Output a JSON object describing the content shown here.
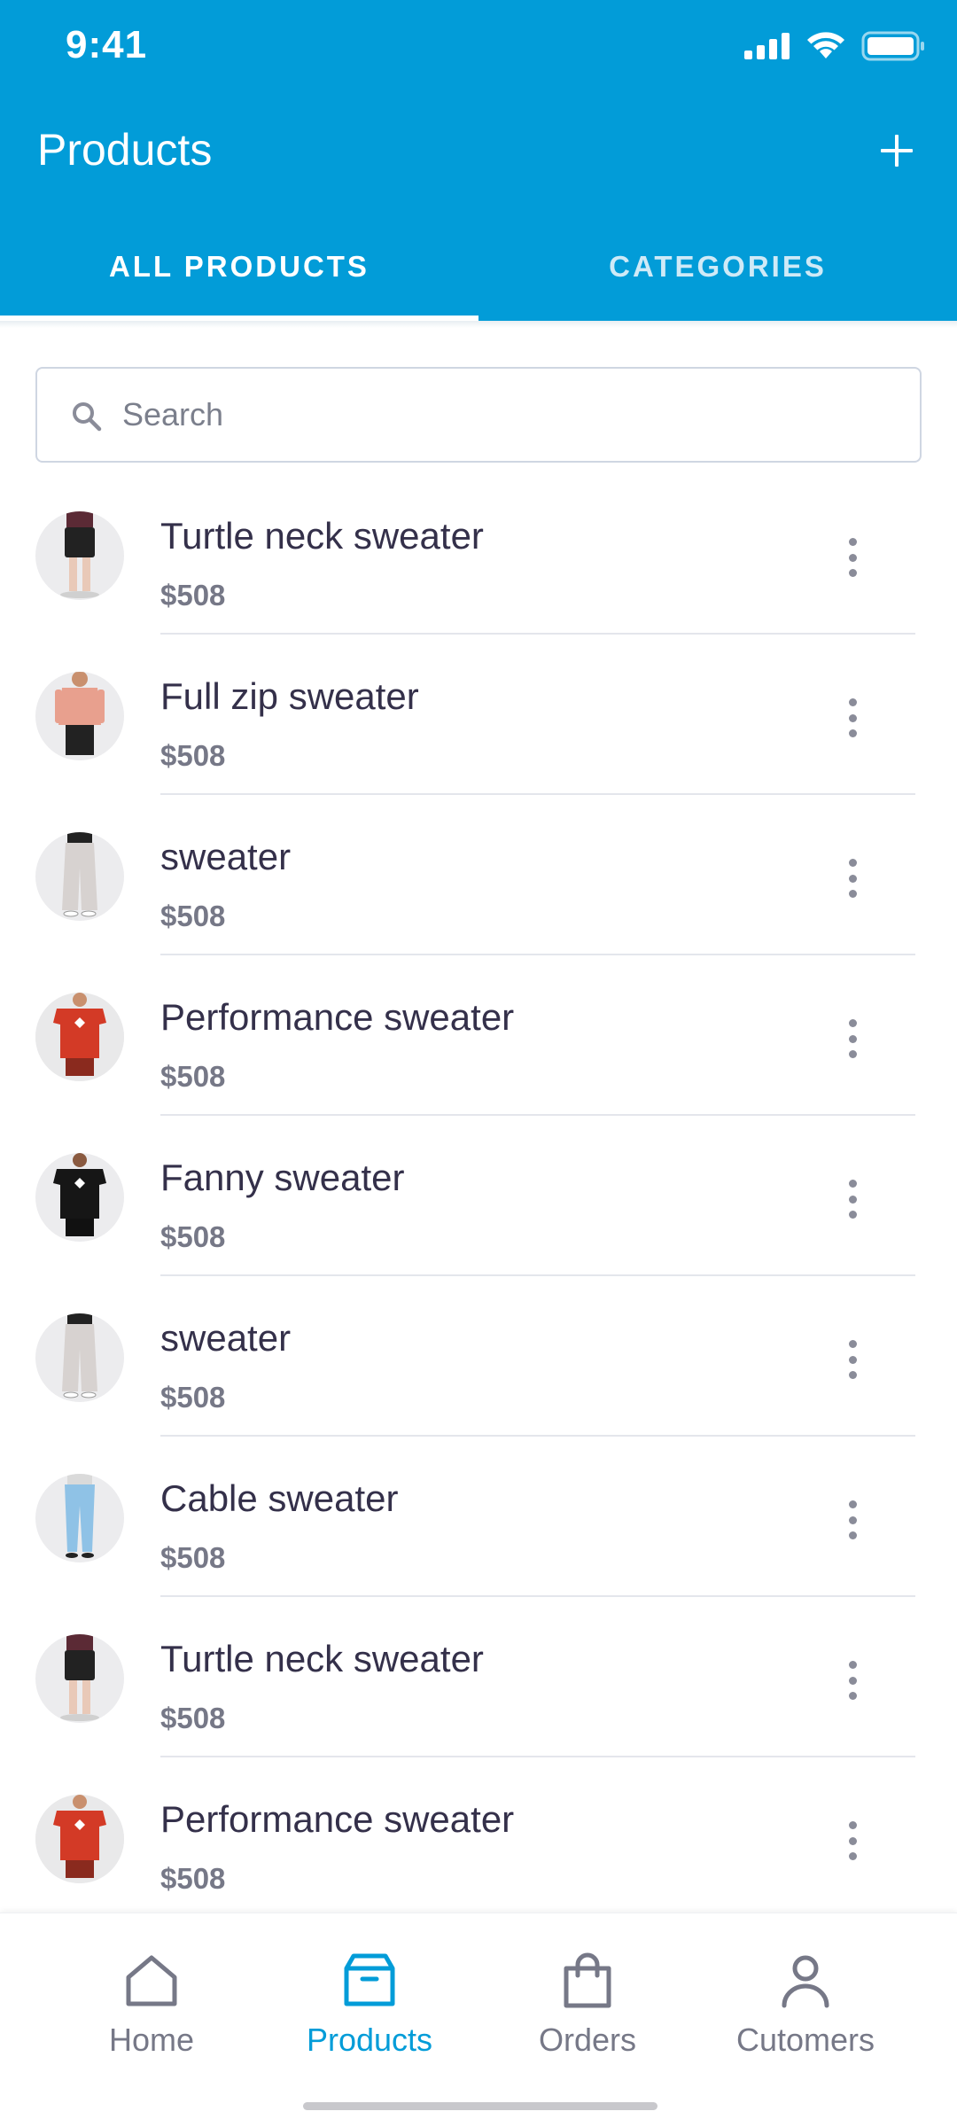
{
  "status_bar": {
    "time": "9:41"
  },
  "header": {
    "title": "Products",
    "add_icon": "plus-icon"
  },
  "tabs": [
    {
      "label": "ALL PRODUCTS",
      "active": true
    },
    {
      "label": "CATEGORIES",
      "active": false
    }
  ],
  "search": {
    "placeholder": "Search",
    "value": ""
  },
  "products": [
    {
      "name": "Turtle neck sweater",
      "price": "$508",
      "thumb": "black-shorts"
    },
    {
      "name": "Full zip sweater",
      "price": "$508",
      "thumb": "pink-top"
    },
    {
      "name": "sweater",
      "price": "$508",
      "thumb": "beige-pants"
    },
    {
      "name": "Performance sweater",
      "price": "$508",
      "thumb": "red-tee"
    },
    {
      "name": "Fanny sweater",
      "price": "$508",
      "thumb": "black-tee"
    },
    {
      "name": "sweater",
      "price": "$508",
      "thumb": "beige-pants"
    },
    {
      "name": "Cable sweater",
      "price": "$508",
      "thumb": "blue-jeans"
    },
    {
      "name": "Turtle neck sweater",
      "price": "$508",
      "thumb": "black-shorts"
    },
    {
      "name": "Performance sweater",
      "price": "$508",
      "thumb": "red-tee"
    }
  ],
  "bottom_nav": [
    {
      "label": "Home",
      "icon": "home-icon",
      "active": false
    },
    {
      "label": "Products",
      "icon": "box-icon",
      "active": true
    },
    {
      "label": "Orders",
      "icon": "shopping-bag-icon",
      "active": false
    },
    {
      "label": "Cutomers",
      "icon": "user-icon",
      "active": false
    }
  ],
  "colors": {
    "primary": "#029cd8",
    "text": "#34304a",
    "muted": "#767887",
    "divider": "#e4e6ec"
  }
}
